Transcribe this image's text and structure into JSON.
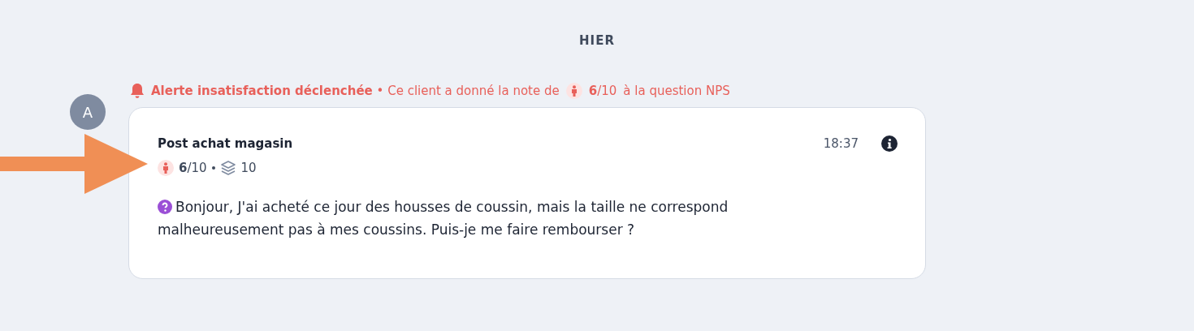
{
  "day_separator": "HIER",
  "avatar": {
    "initial": "A"
  },
  "alert": {
    "message": "**Alerte insatisfaction déclenchée** • Ce client a donné la note de",
    "score": "**6**/10",
    "suffix": "à la question NPS"
  },
  "message": {
    "survey": "Post achat magasin",
    "time": "18:37",
    "score": "**6**/10",
    "responses": "10",
    "text": "Bonjour, J'ai acheté ce jour des housses de coussin, mais la taille ne correspond malheureusement pas à mes coussins. Puis-je me faire rembourser ?"
  }
}
